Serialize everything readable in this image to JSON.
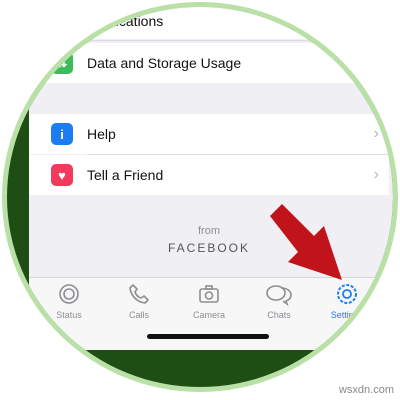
{
  "menu": {
    "cut_item_label": "Notifications",
    "data_storage_label": "Data and Storage Usage",
    "help_label": "Help",
    "tell_friend_label": "Tell a Friend"
  },
  "footer": {
    "from": "from",
    "brand": "FACEBOOK"
  },
  "tabs": [
    {
      "label": "Status",
      "icon": "status-icon"
    },
    {
      "label": "Calls",
      "icon": "phone-icon"
    },
    {
      "label": "Camera",
      "icon": "camera-icon"
    },
    {
      "label": "Chats",
      "icon": "chat-bubbles-icon"
    },
    {
      "label": "Settings",
      "icon": "gear-icon",
      "active": true
    }
  ],
  "colors": {
    "active_tab": "#1e7cf2",
    "help_icon_bg": "#1e7cf2",
    "tell_friend_icon_bg": "#f23b5c",
    "arrow": "#c0141a",
    "frame_ring": "#b9e0a6",
    "background_green": "#1f4e14"
  },
  "watermark": "wsxdn.com"
}
